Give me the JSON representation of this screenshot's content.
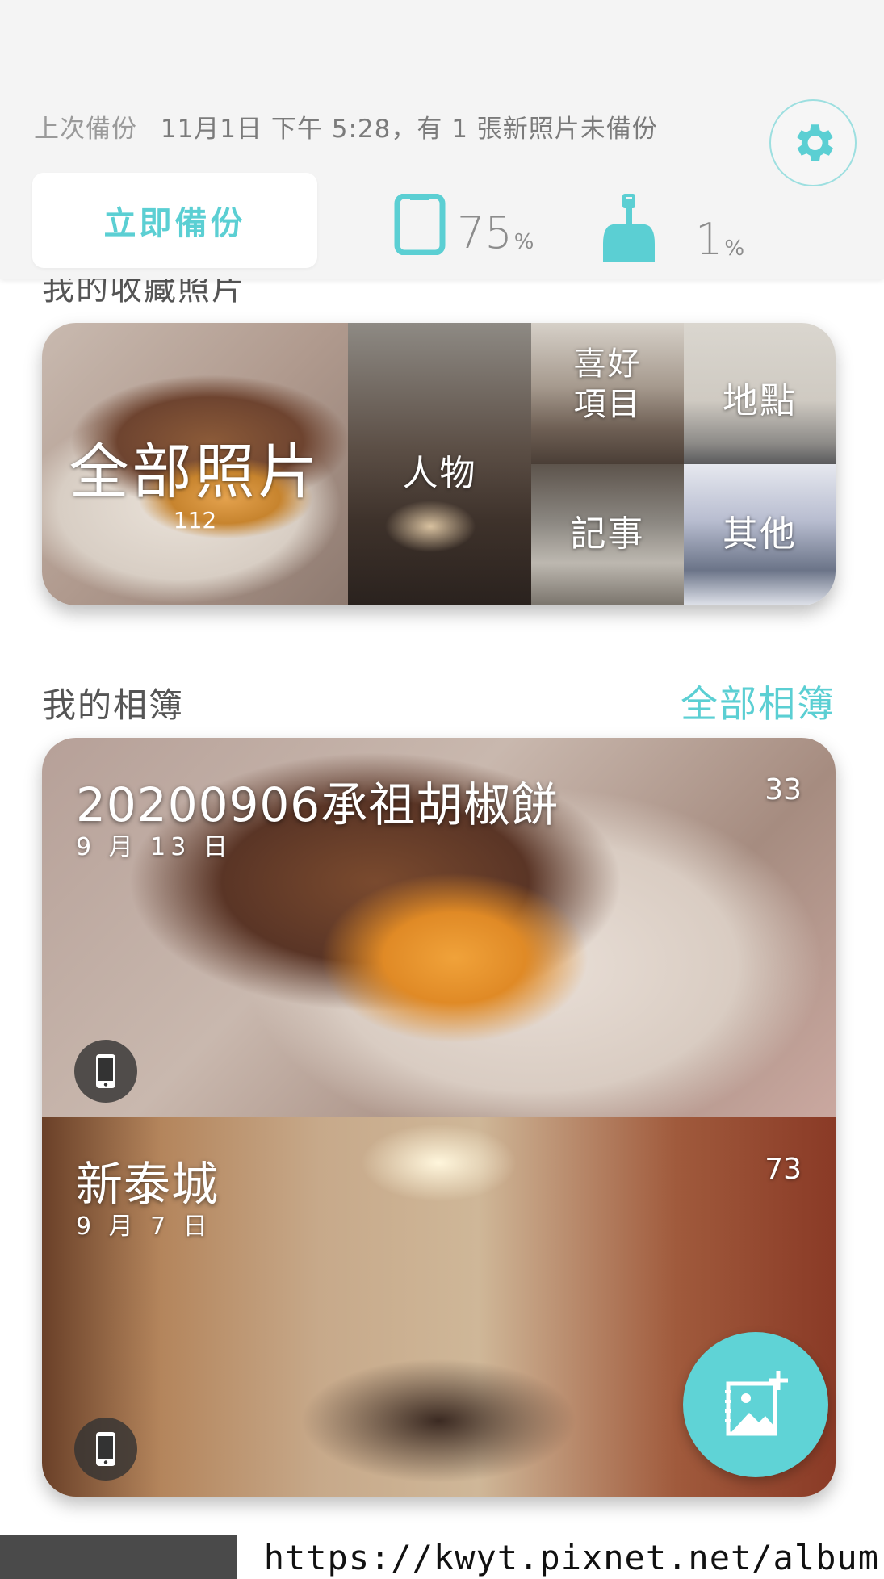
{
  "header": {
    "last_backup_label": "上次備份",
    "last_backup_value": "11月1日 下午 5:28，有 1 張新照片未備份",
    "backup_now_label": "立即備份",
    "phone_storage_value": "75",
    "phone_storage_unit": "%",
    "cleanup_value": "1",
    "cleanup_unit": "%",
    "accent_color": "#5bcfd3"
  },
  "favorites": {
    "title": "我的收藏照片",
    "tiles": {
      "all": {
        "label": "全部照片",
        "count": "112"
      },
      "people": {
        "label": "人物"
      },
      "likes": {
        "label": "喜好\n項目"
      },
      "places": {
        "label": "地點"
      },
      "notes": {
        "label": "記事"
      },
      "other": {
        "label": "其他"
      }
    }
  },
  "albums": {
    "title": "我的相簿",
    "view_all_label": "全部相簿",
    "items": [
      {
        "title": "20200906承祖胡椒餅",
        "date": "9 月 13 日",
        "count": "33",
        "source_icon": "phone-icon"
      },
      {
        "title": "新泰城",
        "date": "9 月 7 日",
        "count": "73",
        "source_icon": "phone-icon"
      }
    ]
  },
  "fab": {
    "icon": "add-album-icon"
  },
  "url_bar": {
    "text": "https://kwyt.pixnet.net/album"
  }
}
